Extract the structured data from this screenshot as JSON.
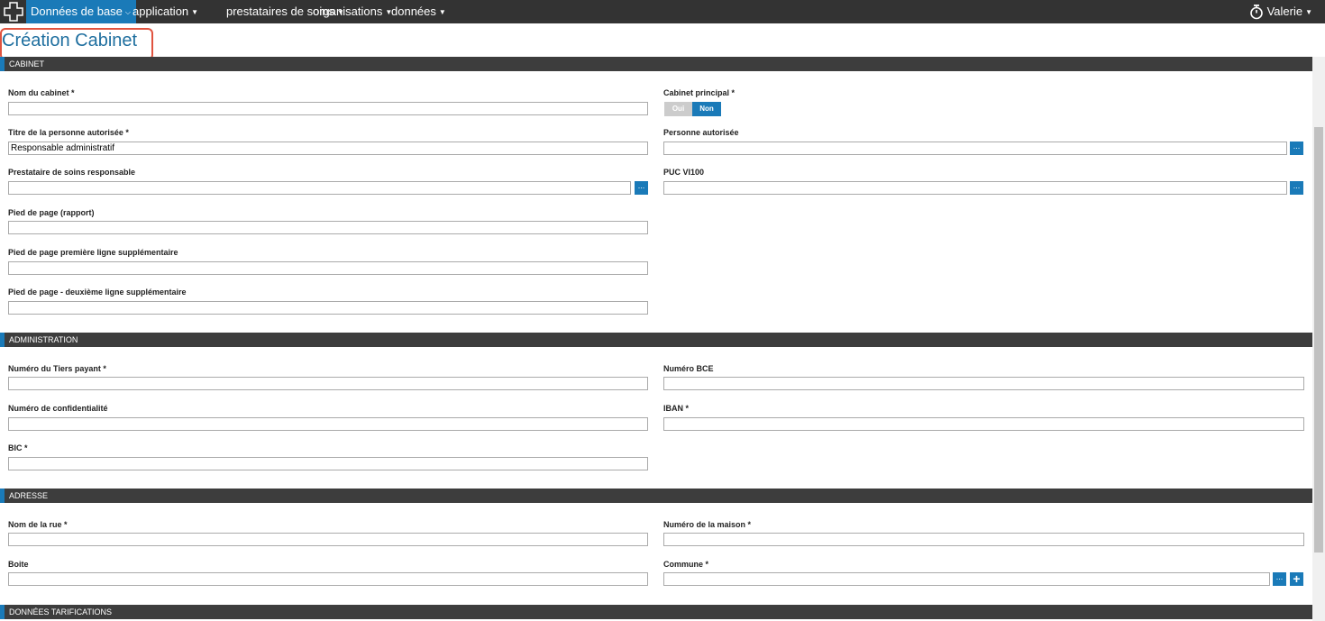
{
  "nav": {
    "items": [
      {
        "label": "Données de base",
        "active": true
      },
      {
        "label": "application"
      },
      {
        "label": "prestataires de soins"
      },
      {
        "label": "organisations"
      },
      {
        "label": "données"
      }
    ],
    "user": "Valerie",
    "accent_color": "#1a7ab8"
  },
  "page": {
    "title": "Création Cabinet"
  },
  "sections": {
    "cabinet": "CABINET",
    "administration": "ADMINISTRATION",
    "adresse": "ADRESSE",
    "tarifs": "DONNÉES TARIFICATIONS"
  },
  "fields": {
    "nom_cabinet": {
      "label": "Nom du cabinet *",
      "value": ""
    },
    "cabinet_principal": {
      "label": "Cabinet principal *",
      "options": [
        "Oui",
        "Non"
      ],
      "selected": "Non"
    },
    "titre_personne": {
      "label": "Titre de la personne autorisée *",
      "value": "Responsable administratif"
    },
    "personne_autorisee": {
      "label": "Personne autorisée",
      "value": ""
    },
    "prestataire": {
      "label": "Prestataire de soins responsable",
      "value": ""
    },
    "puc": {
      "label": "PUC VI100",
      "value": ""
    },
    "pied_page": {
      "label": "Pied de page (rapport)",
      "value": ""
    },
    "pied_page_1": {
      "label": "Pied de page première ligne supplémentaire",
      "value": ""
    },
    "pied_page_2": {
      "label": "Pied de page - deuxième ligne supplémentaire",
      "value": ""
    },
    "tiers_payant": {
      "label": "Numéro du Tiers payant *",
      "value": ""
    },
    "bce": {
      "label": "Numéro BCE",
      "value": ""
    },
    "confidentialite": {
      "label": "Numéro de confidentialité",
      "value": ""
    },
    "iban": {
      "label": "IBAN *",
      "value": ""
    },
    "bic": {
      "label": "BIC *",
      "value": ""
    },
    "rue": {
      "label": "Nom de la rue *",
      "value": ""
    },
    "maison": {
      "label": "Numéro de la maison *",
      "value": ""
    },
    "boite": {
      "label": "Boite",
      "value": ""
    },
    "commune": {
      "label": "Commune *",
      "value": ""
    }
  },
  "buttons": {
    "pick": "...",
    "add": "+"
  }
}
